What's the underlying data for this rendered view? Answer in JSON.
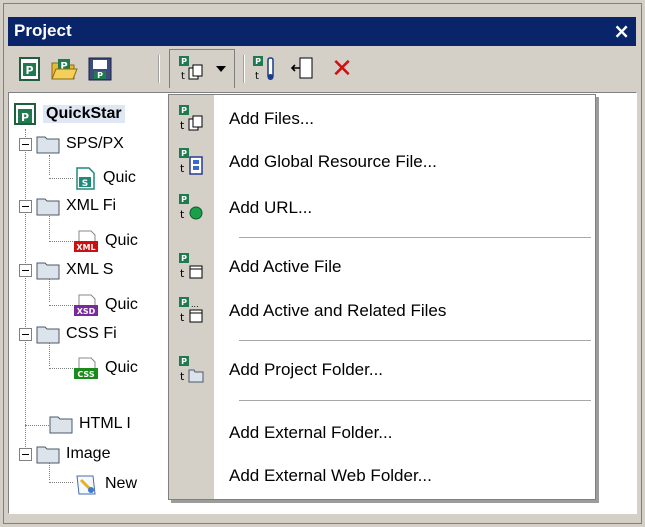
{
  "window": {
    "title": "Project",
    "close_glyph": "×"
  },
  "toolbar": {
    "buttons": [
      {
        "name": "new-project-icon"
      },
      {
        "name": "open-project-icon"
      },
      {
        "name": "save-project-icon"
      },
      {
        "name": "add-files-dropdown-icon"
      },
      {
        "name": "project-properties-icon"
      },
      {
        "name": "add-active-file-icon"
      },
      {
        "name": "delete-icon"
      }
    ],
    "delete_glyph": "✕"
  },
  "tree": {
    "root": "QuickStar",
    "items": [
      {
        "label": "SPS/PX",
        "type": "folder"
      },
      {
        "label": "Quic",
        "type": "file",
        "badge": "S",
        "badge_color": "#1e8a7a"
      },
      {
        "label": "XML Fi",
        "type": "folder"
      },
      {
        "label": "Quic",
        "type": "file",
        "badge": "XML",
        "badge_color": "#cc1010"
      },
      {
        "label": "XML S",
        "type": "folder"
      },
      {
        "label": "Quic",
        "type": "file",
        "badge": "XSD",
        "badge_color": "#7a2a9a"
      },
      {
        "label": "CSS Fi",
        "type": "folder"
      },
      {
        "label": "Quic",
        "type": "file",
        "badge": "CSS",
        "badge_color": "#1a8a1a"
      },
      {
        "label": "HTML I",
        "type": "folder"
      },
      {
        "label": "Image",
        "type": "folder"
      },
      {
        "label": "New",
        "type": "file"
      }
    ]
  },
  "menu": {
    "items": [
      {
        "label": "Add Files...",
        "icon": "add-files-icon"
      },
      {
        "label": "Add Global Resource File...",
        "icon": "add-global-resource-icon"
      },
      {
        "label": "Add URL...",
        "icon": "add-url-icon"
      },
      {
        "label": "Add Active File",
        "icon": "add-active-file-icon"
      },
      {
        "label": "Add Active and Related Files",
        "icon": "add-related-files-icon"
      },
      {
        "label": "Add Project Folder...",
        "icon": "add-project-folder-icon"
      },
      {
        "label": "Add External Folder...",
        "icon": ""
      },
      {
        "label": "Add External Web Folder...",
        "icon": ""
      }
    ]
  }
}
